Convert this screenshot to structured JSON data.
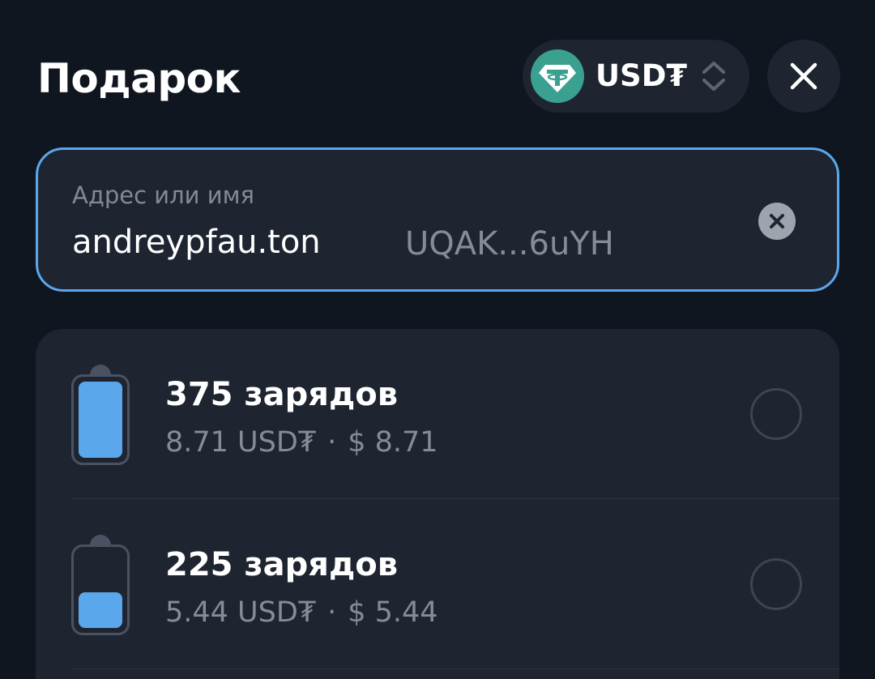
{
  "header": {
    "title": "Подарок",
    "currency": {
      "label": "USD₮",
      "icon": "tether-icon",
      "icon_color": "#3aa191"
    },
    "close_icon": "close-icon"
  },
  "address": {
    "label": "Адрес или имя",
    "value": "andreypfau.ton",
    "resolved_address": "UQAK...6uYH",
    "clear_icon": "clear-icon"
  },
  "options": [
    {
      "title": "375 зарядов",
      "price_token": "8.71 USD₮",
      "separator": "·",
      "price_usd": "$ 8.71",
      "battery_level": 1.0,
      "selected": false
    },
    {
      "title": "225 зарядов",
      "price_token": "5.44 USD₮",
      "separator": "·",
      "price_usd": "$ 5.44",
      "battery_level": 0.45,
      "selected": false
    }
  ],
  "colors": {
    "background": "#10161f",
    "surface": "#1e2531",
    "accent": "#5aa7ec",
    "secondary_text": "#858c98"
  }
}
